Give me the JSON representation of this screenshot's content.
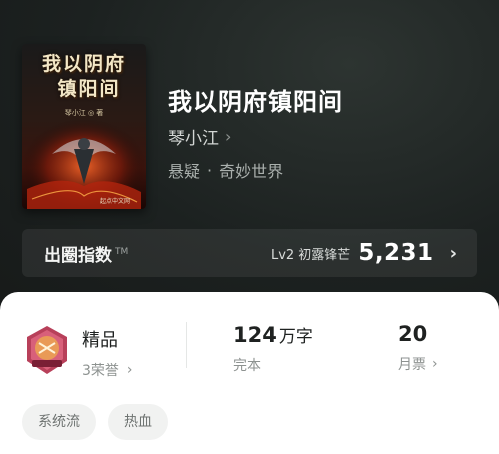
{
  "book": {
    "cover_title_line1": "我以阴府",
    "cover_title_line2": "镇阳间",
    "cover_author": "琴小江 ◎ 著",
    "cover_publisher": "起点中文网",
    "title": "我以阴府镇阳间",
    "author": "琴小江",
    "genre_primary": "悬疑",
    "genre_separator": "·",
    "genre_secondary": "奇妙世界"
  },
  "index": {
    "label": "出圈指数",
    "tm": "TM",
    "level": "Lv2 初露锋芒",
    "score": "5,231"
  },
  "stats": {
    "badge_text": "精品",
    "honors": "3荣誉",
    "word_count": "124",
    "word_unit": "万字",
    "status": "完本",
    "monthly_votes": "20",
    "monthly_votes_label": "月票"
  },
  "tags": [
    "系统流",
    "热血"
  ],
  "icons": {
    "author_chevron": "chevron-right-icon",
    "index_chevron": "chevron-right-icon",
    "honors_chevron": "chevron-right-icon",
    "votes_chevron": "chevron-right-icon",
    "badge": "premium-badge-icon"
  }
}
